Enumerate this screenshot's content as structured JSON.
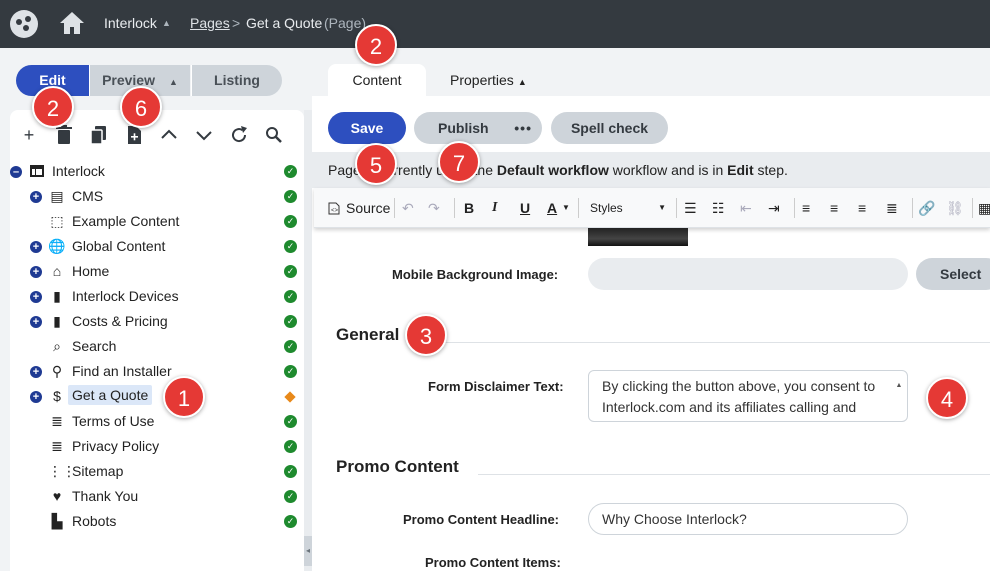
{
  "topbar": {
    "site_name": "Interlock",
    "breadcrumb_pages": "Pages",
    "breadcrumb_sep": ">",
    "current_page": "Get a Quote",
    "page_type": "(Page)"
  },
  "mode_tabs": {
    "edit": "Edit",
    "preview": "Preview",
    "listing": "Listing"
  },
  "tree_toolbar_icons": [
    "add-icon",
    "delete-icon",
    "copy-icon",
    "new-page-icon",
    "move-up-icon",
    "move-down-icon",
    "refresh-icon",
    "search-icon"
  ],
  "tree": {
    "root": "Interlock",
    "items": [
      {
        "label": "CMS",
        "icon": "document-icon",
        "status": "published"
      },
      {
        "label": "Example Content",
        "icon": "dashed-box-icon",
        "status": "published"
      },
      {
        "label": "Global Content",
        "icon": "globe-icon",
        "status": "published"
      },
      {
        "label": "Home",
        "icon": "home-icon",
        "status": "published"
      },
      {
        "label": "Interlock Devices",
        "icon": "book-icon",
        "status": "published"
      },
      {
        "label": "Costs & Pricing",
        "icon": "book-icon",
        "status": "published"
      },
      {
        "label": "Search",
        "icon": "search-icon",
        "status": "published"
      },
      {
        "label": "Find an Installer",
        "icon": "map-pin-icon",
        "status": "published"
      },
      {
        "label": "Get a Quote",
        "icon": "dollar-icon",
        "status": "draft"
      },
      {
        "label": "Terms of Use",
        "icon": "list-icon",
        "status": "published"
      },
      {
        "label": "Privacy Policy",
        "icon": "list-icon",
        "status": "published"
      },
      {
        "label": "Sitemap",
        "icon": "sitemap-icon",
        "status": "published"
      },
      {
        "label": "Thank You",
        "icon": "heart-icon",
        "status": "published"
      },
      {
        "label": "Robots",
        "icon": "robot-icon",
        "status": "published"
      }
    ]
  },
  "content_tabs": {
    "content": "Content",
    "properties": "Properties"
  },
  "actions": {
    "save": "Save",
    "publish": "Publish",
    "more": "•••",
    "spell_check": "Spell check"
  },
  "workflow": {
    "prefix": "Page is currently using the ",
    "workflow_name": "Default workflow",
    "middle": " workflow and is in ",
    "step": "Edit",
    "suffix": " step."
  },
  "editor_toolbar": {
    "source": "Source",
    "styles": "Styles"
  },
  "fields": {
    "mobile_bg_label": "Mobile Background Image:",
    "select_label": "Select",
    "general_section": "General",
    "disclaimer_label": "Form Disclaimer Text:",
    "disclaimer_value": "By clicking the button above, you consent to Interlock.com and its affiliates calling and",
    "promo_section": "Promo Content",
    "promo_headline_label": "Promo Content Headline:",
    "promo_headline_value": "Why Choose Interlock?",
    "promo_items_label": "Promo Content Items:"
  },
  "callouts": [
    "2",
    "2",
    "6",
    "5",
    "7",
    "3",
    "1",
    "4"
  ],
  "colors": {
    "primary": "#2d4fbf",
    "published": "#1e8a2e",
    "draft": "#e8891a",
    "callout": "#e53935"
  }
}
